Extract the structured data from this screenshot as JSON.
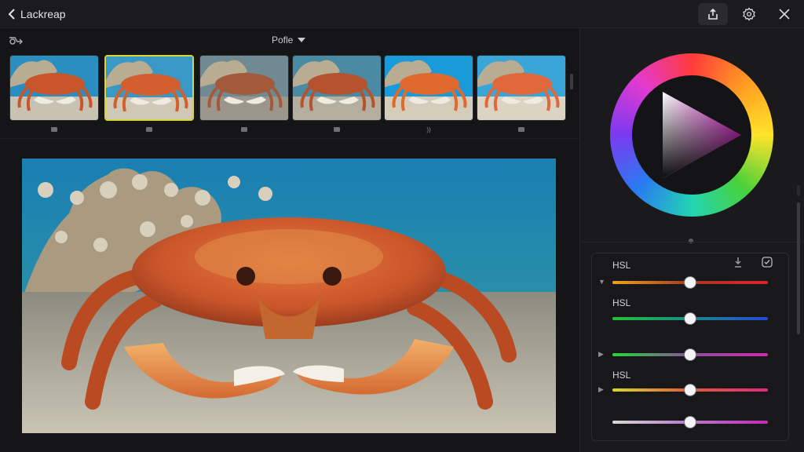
{
  "app": {
    "back_label": "Lackreap"
  },
  "header": {
    "share_icon": "share-icon",
    "settings_icon": "gear-icon",
    "close_icon": "close-icon"
  },
  "toolbar": {
    "preset_label": "Pofle"
  },
  "filmstrip": {
    "selected_index": 1,
    "thumbnails": [
      {
        "tone": "normal",
        "marker": "square"
      },
      {
        "tone": "warm",
        "marker": "square"
      },
      {
        "tone": "faded",
        "marker": "square"
      },
      {
        "tone": "muted",
        "marker": "square"
      },
      {
        "tone": "vivid",
        "marker": "wave"
      },
      {
        "tone": "bright",
        "marker": "square"
      }
    ]
  },
  "hsl": {
    "rows": [
      {
        "label": "HSL",
        "expanded": true,
        "value": 0.5,
        "gradient": [
          "#f0a020",
          "#a23a20",
          "#e02030"
        ]
      },
      {
        "label": "HSL",
        "expanded": true,
        "value": 0.5,
        "gradient": [
          "#22c23a",
          "#1a8a8a",
          "#2448d8"
        ]
      },
      {
        "label": "",
        "expanded": false,
        "value": 0.5,
        "gradient": [
          "#28d43a",
          "#8a50a0",
          "#d02aa8"
        ]
      },
      {
        "label": "HSL",
        "expanded": false,
        "value": 0.5,
        "gradient": [
          "#d8d82a",
          "#e05a3a",
          "#e02a7a"
        ]
      },
      {
        "label": "",
        "expanded": false,
        "value": 0.5,
        "gradient": [
          "#d8d8d8",
          "#b878c8",
          "#c02ab8"
        ]
      }
    ]
  },
  "colors": {
    "accent_selected": "#d7d43a"
  }
}
